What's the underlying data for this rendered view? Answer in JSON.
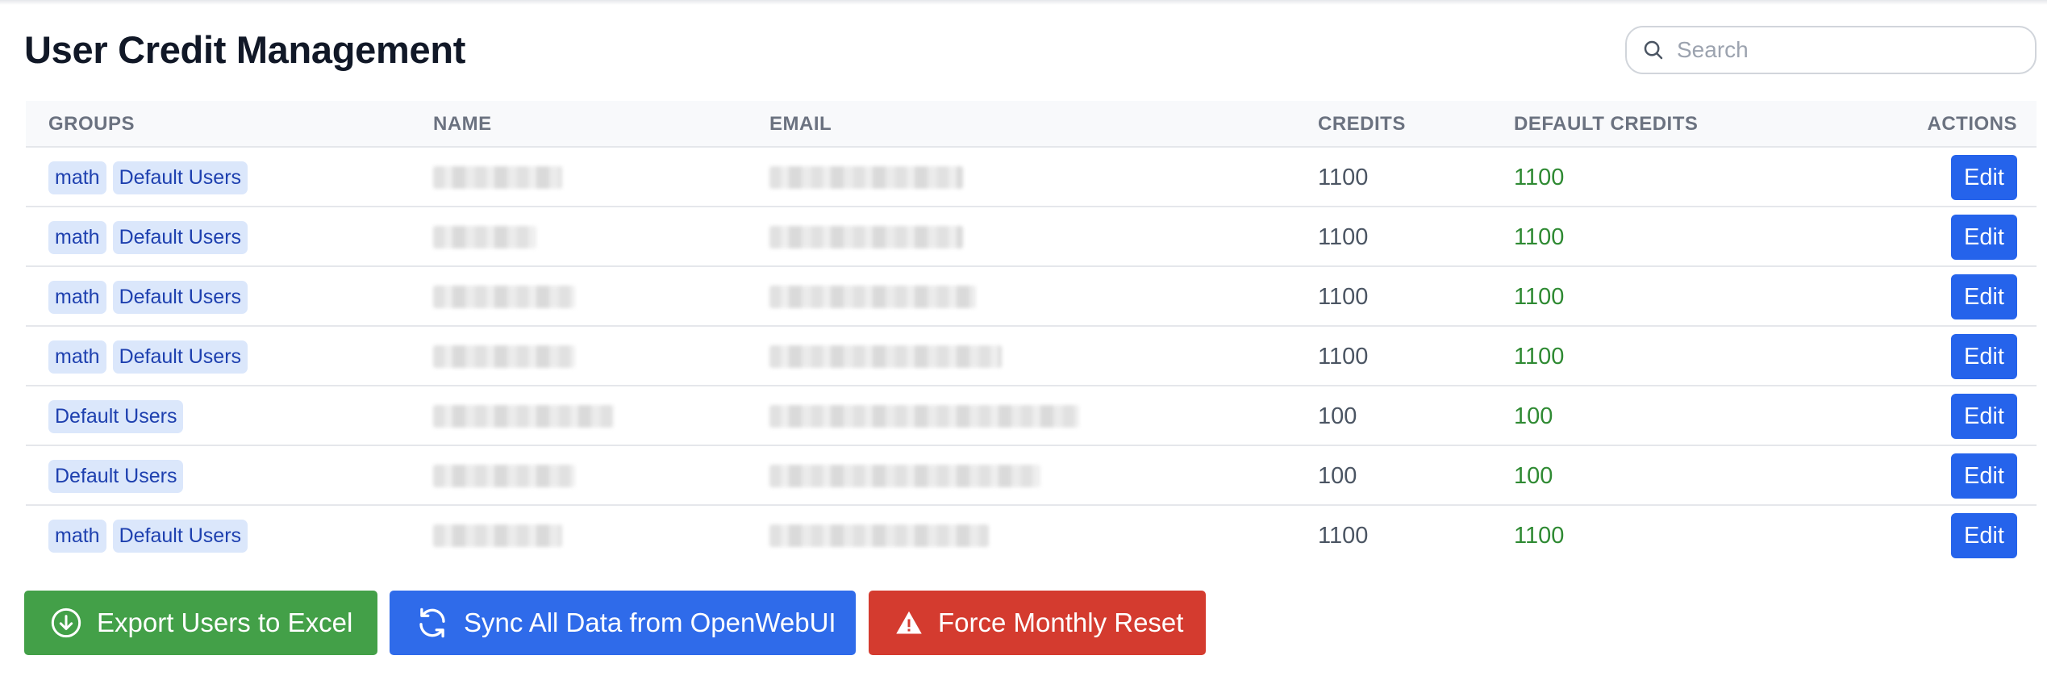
{
  "page": {
    "title": "User Credit Management"
  },
  "search": {
    "placeholder": "Search",
    "icon": "search-icon"
  },
  "table": {
    "headers": {
      "groups": "GROUPS",
      "name": "NAME",
      "email": "EMAIL",
      "credits": "CREDITS",
      "default_credits": "DEFAULT CREDITS",
      "actions": "ACTIONS"
    },
    "rows": [
      {
        "groups": [
          "math",
          "Default Users"
        ],
        "credits": "1100",
        "default_credits": "1100",
        "action": "Edit"
      },
      {
        "groups": [
          "math",
          "Default Users"
        ],
        "credits": "1100",
        "default_credits": "1100",
        "action": "Edit"
      },
      {
        "groups": [
          "math",
          "Default Users"
        ],
        "credits": "1100",
        "default_credits": "1100",
        "action": "Edit"
      },
      {
        "groups": [
          "math",
          "Default Users"
        ],
        "credits": "1100",
        "default_credits": "1100",
        "action": "Edit"
      },
      {
        "groups": [
          "Default Users"
        ],
        "credits": "100",
        "default_credits": "100",
        "action": "Edit"
      },
      {
        "groups": [
          "Default Users"
        ],
        "credits": "100",
        "default_credits": "100",
        "action": "Edit"
      },
      {
        "groups": [
          "math",
          "Default Users"
        ],
        "credits": "1100",
        "default_credits": "1100",
        "action": "Edit"
      }
    ]
  },
  "actions": {
    "export_label": "Export Users to Excel",
    "sync_label": "Sync All Data from OpenWebUI",
    "reset_label": "Force Monthly Reset"
  },
  "colors": {
    "primary": "#2563eb",
    "export": "#43a048",
    "danger": "#d43b2f",
    "default_credits_text": "#2f8a33",
    "tag_bg": "#dbe7fb"
  }
}
